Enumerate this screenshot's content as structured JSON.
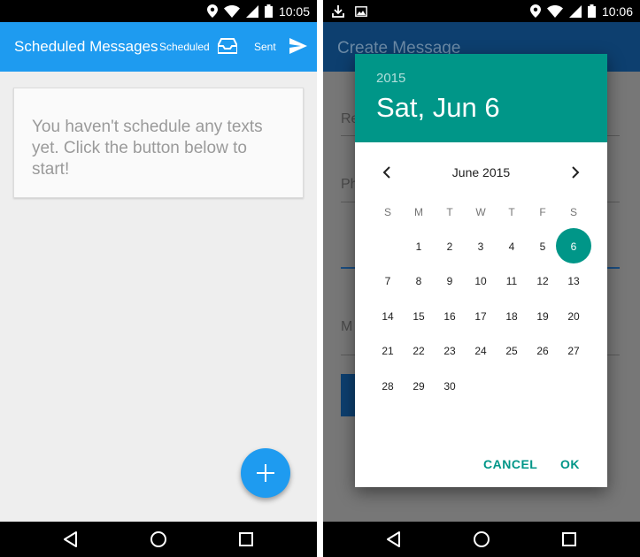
{
  "left_screen": {
    "status_bar": {
      "time": "10:05"
    },
    "app_bar": {
      "title": "Scheduled Messages",
      "tab_scheduled": "Scheduled",
      "tab_sent": "Sent"
    },
    "empty_state": {
      "line1": "You haven't schedule any texts",
      "line2": "yet. Click the button below to",
      "line3": "start!"
    },
    "fab_icon": "plus-icon"
  },
  "right_screen": {
    "status_bar": {
      "time": "10:06"
    },
    "background": {
      "title": "Create Message",
      "label1": "Re",
      "label2": "Ph",
      "label3": "M"
    },
    "date_picker": {
      "year": "2015",
      "selected_date": "Sat, Jun 6",
      "month": "June 2015",
      "weekdays": [
        "S",
        "M",
        "T",
        "W",
        "T",
        "F",
        "S"
      ],
      "days": [
        "1",
        "2",
        "3",
        "4",
        "5",
        "6",
        "7",
        "8",
        "9",
        "10",
        "11",
        "12",
        "13",
        "14",
        "15",
        "16",
        "17",
        "18",
        "19",
        "20",
        "21",
        "22",
        "23",
        "24",
        "25",
        "26",
        "27",
        "28",
        "29",
        "30"
      ],
      "selected_day": "6",
      "cancel_label": "CANCEL",
      "ok_label": "OK"
    }
  },
  "colors": {
    "app_blue": "#1e9bf0",
    "teal": "#009688",
    "dim_appbar": "#0d3f6f"
  }
}
